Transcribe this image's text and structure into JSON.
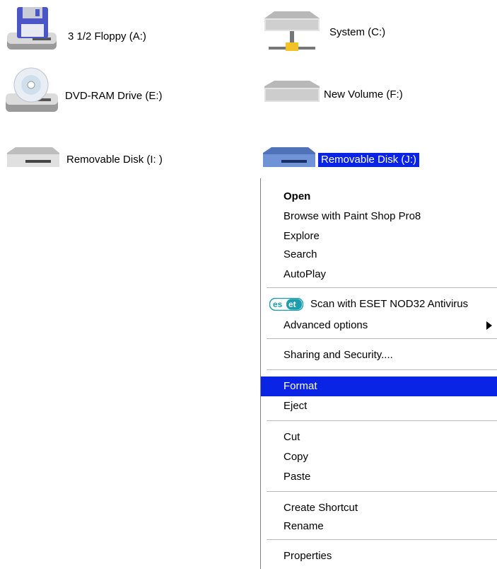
{
  "drives": [
    {
      "label": "3 1/2 Floppy (A:)",
      "icon": "floppy-drive-icon"
    },
    {
      "label": "System (C:)",
      "icon": "network-drive-icon"
    },
    {
      "label": "DVD-RAM Drive (E:)",
      "icon": "dvd-drive-icon"
    },
    {
      "label": "New Volume (F:)",
      "icon": "hard-drive-icon"
    },
    {
      "label": "Removable Disk (I: )",
      "icon": "removable-disk-icon"
    },
    {
      "label": "Removable Disk (J:)",
      "icon": "removable-disk-icon",
      "selected": true
    }
  ],
  "menu": {
    "open": "Open",
    "browse": "Browse with Paint Shop Pro8",
    "explore": "Explore",
    "search": "Search",
    "autoplay": "AutoPlay",
    "eset_logo": "eset",
    "scan": "Scan with ESET NOD32 Antivirus",
    "advanced": "Advanced options",
    "sharing": "Sharing and Security....",
    "format": "Format",
    "eject": "Eject",
    "cut": "Cut",
    "copy": "Copy",
    "paste": "Paste",
    "create_shortcut": "Create Shortcut",
    "rename": "Rename",
    "properties": "Properties"
  },
  "colors": {
    "selection": "#0a24e6",
    "eset_brand": "#1a9db0"
  }
}
